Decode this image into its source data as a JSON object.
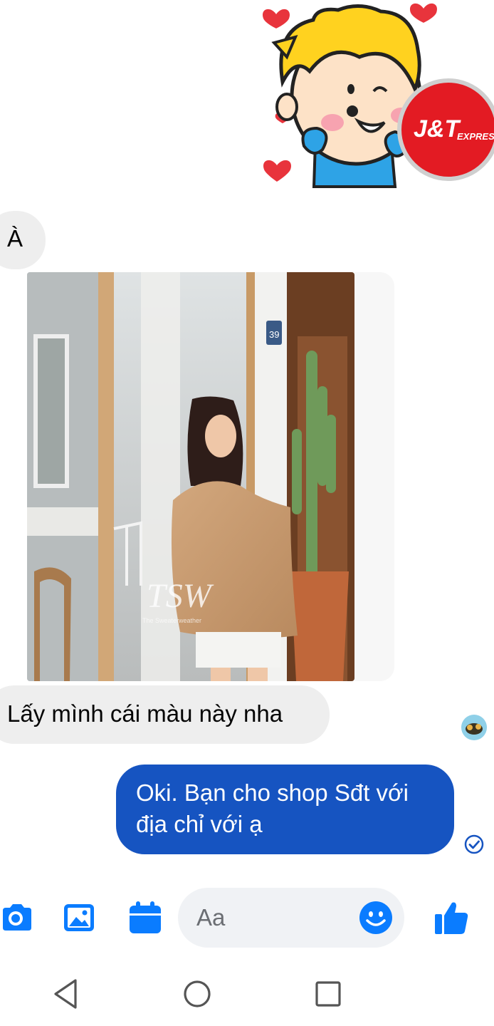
{
  "conversation": {
    "messages": [
      {
        "from": "them",
        "type": "text",
        "text": "À"
      },
      {
        "from": "them",
        "type": "image"
      },
      {
        "from": "them",
        "type": "text",
        "text": "Lấy mình cái màu này nha"
      },
      {
        "from": "me",
        "type": "text",
        "text": "Oki. Bạn cho shop Sđt với địa chỉ với ạ"
      }
    ],
    "sticker_brand": {
      "main": "J&T",
      "sub": "EXPRESS"
    },
    "photo": {
      "door_number": "39",
      "watermark": "TSW",
      "watermark_sub": "The Sweaterweather"
    }
  },
  "composer": {
    "placeholder": "Aa",
    "icons": [
      "camera-icon",
      "image-icon",
      "calendar-icon",
      "emoji-icon",
      "thumbs-up-icon"
    ]
  },
  "colors": {
    "accent": "#0a7cff",
    "outgoing_bubble": "#1654c1",
    "incoming_bubble": "#eeeeee",
    "composer_fill": "#f0f2f5"
  },
  "navbar": {
    "icons": [
      "back-triangle-icon",
      "home-circle-icon",
      "recents-square-icon"
    ]
  }
}
